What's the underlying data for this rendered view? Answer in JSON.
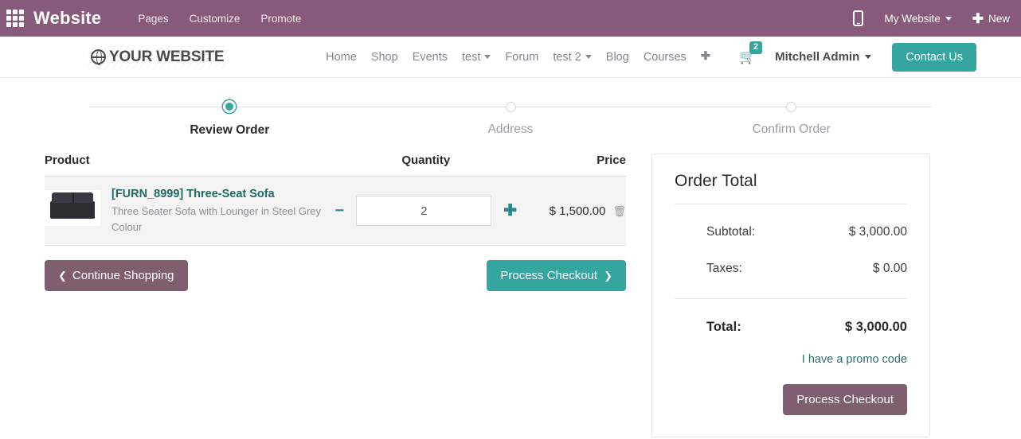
{
  "backend_bar": {
    "apps_icon": "apps-grid-icon",
    "brand": "Website",
    "menu": [
      {
        "label": "Pages"
      },
      {
        "label": "Customize"
      },
      {
        "label": "Promote"
      }
    ],
    "mobile_preview_icon": "mobile-phone-icon",
    "website_selector": "My Website",
    "new_label": "New",
    "new_icon": "plus-icon",
    "bar_color": "#875A7B"
  },
  "site_nav": {
    "logo_text": "YOUR WEBSITE",
    "logo_icon": "globe-icon",
    "links": [
      {
        "label": "Home",
        "dropdown": false
      },
      {
        "label": "Shop",
        "dropdown": false
      },
      {
        "label": "Events",
        "dropdown": false
      },
      {
        "label": "test",
        "dropdown": true
      },
      {
        "label": "Forum",
        "dropdown": false
      },
      {
        "label": "test 2",
        "dropdown": true
      },
      {
        "label": "Blog",
        "dropdown": false
      },
      {
        "label": "Courses",
        "dropdown": false
      }
    ],
    "add_page_icon": "plus-icon",
    "cart_icon": "shopping-cart-icon",
    "cart_count": "2",
    "user_name": "Mitchell Admin",
    "contact_button": "Contact Us",
    "accent_color": "#35A5A0"
  },
  "wizard": {
    "steps": [
      {
        "label": "Review Order",
        "active": true
      },
      {
        "label": "Address",
        "active": false
      },
      {
        "label": "Confirm Order",
        "active": false
      }
    ]
  },
  "cart": {
    "headers": {
      "product": "Product",
      "quantity": "Quantity",
      "price": "Price"
    },
    "rows": [
      {
        "title": "[FURN_8999] Three-Seat Sofa",
        "description": "Three Seater Sofa with Lounger in Steel Grey Colour",
        "image_alt": "three-seat-sofa-thumbnail",
        "decrease_icon": "minus-icon",
        "increase_icon": "plus-icon",
        "quantity": "2",
        "price": "$ 1,500.00",
        "delete_icon": "trash-icon"
      }
    ]
  },
  "actions": {
    "continue_shopping": "Continue Shopping",
    "continue_icon": "chevron-left-icon",
    "process_checkout": "Process Checkout",
    "checkout_icon": "chevron-right-icon"
  },
  "order_total": {
    "title": "Order Total",
    "lines": [
      {
        "label": "Subtotal:",
        "value": "$ 3,000.00"
      },
      {
        "label": "Taxes:",
        "value": "$ 0.00"
      }
    ],
    "grand_label": "Total:",
    "grand_value": "$ 3,000.00",
    "promo_link": "I have a promo code",
    "checkout_button": "Process Checkout"
  }
}
